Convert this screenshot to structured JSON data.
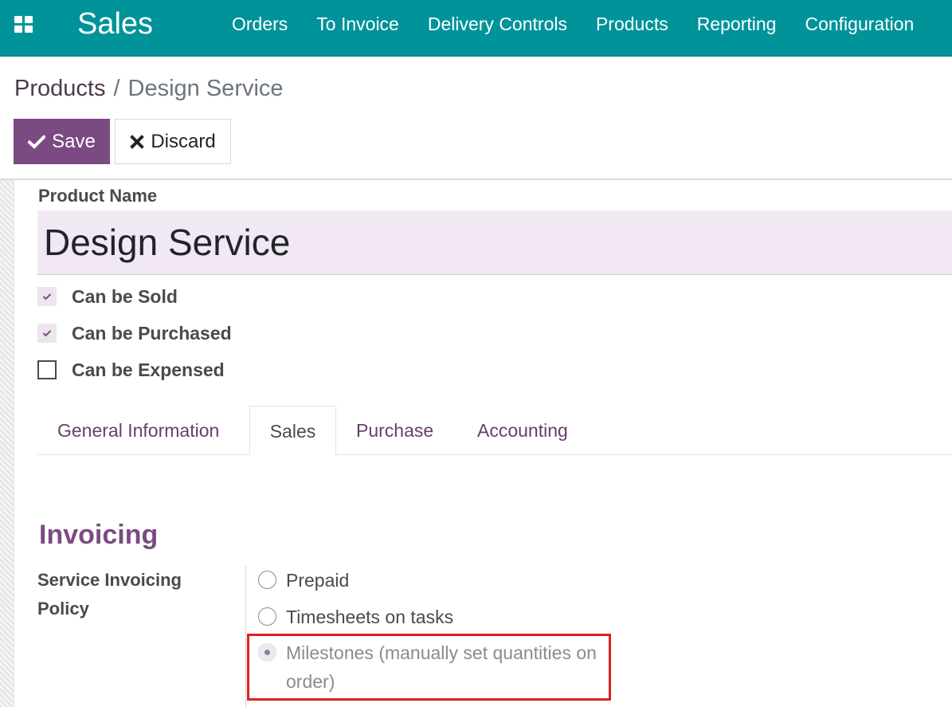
{
  "navbar": {
    "apps_icon": "apps-grid-icon",
    "app_title": "Sales",
    "menu": [
      "Orders",
      "To Invoice",
      "Delivery Controls",
      "Products",
      "Reporting",
      "Configuration"
    ]
  },
  "breadcrumb": {
    "parent": "Products",
    "separator": "/",
    "current": "Design Service"
  },
  "buttons": {
    "save_label": "Save",
    "save_icon": "check-icon",
    "discard_label": "Discard",
    "discard_icon": "close-icon"
  },
  "form": {
    "product_name_label": "Product Name",
    "product_name_value": "Design Service",
    "checkboxes": [
      {
        "label": "Can be Sold",
        "checked": true
      },
      {
        "label": "Can be Purchased",
        "checked": true
      },
      {
        "label": "Can be Expensed",
        "checked": false
      }
    ],
    "tabs": [
      {
        "label": "General Information",
        "active": false
      },
      {
        "label": "Sales",
        "active": true
      },
      {
        "label": "Purchase",
        "active": false
      },
      {
        "label": "Accounting",
        "active": false
      }
    ],
    "invoicing": {
      "title": "Invoicing",
      "policy_label": "Service Invoicing Policy",
      "options": [
        {
          "label": "Prepaid",
          "selected": false
        },
        {
          "label": "Timesheets on tasks",
          "selected": false
        },
        {
          "label": "Milestones (manually set quantities on order)",
          "selected": true
        }
      ]
    }
  },
  "colors": {
    "navbar": "#00939a",
    "primary": "#7c4a82",
    "input_bg": "#f2e8f4",
    "highlight": "#e02020"
  }
}
